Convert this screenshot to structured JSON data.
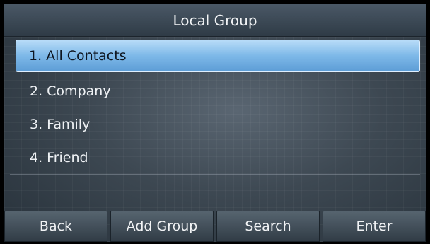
{
  "header": {
    "title": "Local Group"
  },
  "groups": [
    {
      "label": "1. All Contacts",
      "selected": true
    },
    {
      "label": "2. Company",
      "selected": false
    },
    {
      "label": "3. Family",
      "selected": false
    },
    {
      "label": "4. Friend",
      "selected": false
    }
  ],
  "softkeys": [
    {
      "label": "Back"
    },
    {
      "label": "Add Group"
    },
    {
      "label": "Search"
    },
    {
      "label": "Enter"
    }
  ],
  "colors": {
    "selection_highlight": "#7db8e8",
    "background": "#3d4852",
    "text": "#eef1f4"
  }
}
